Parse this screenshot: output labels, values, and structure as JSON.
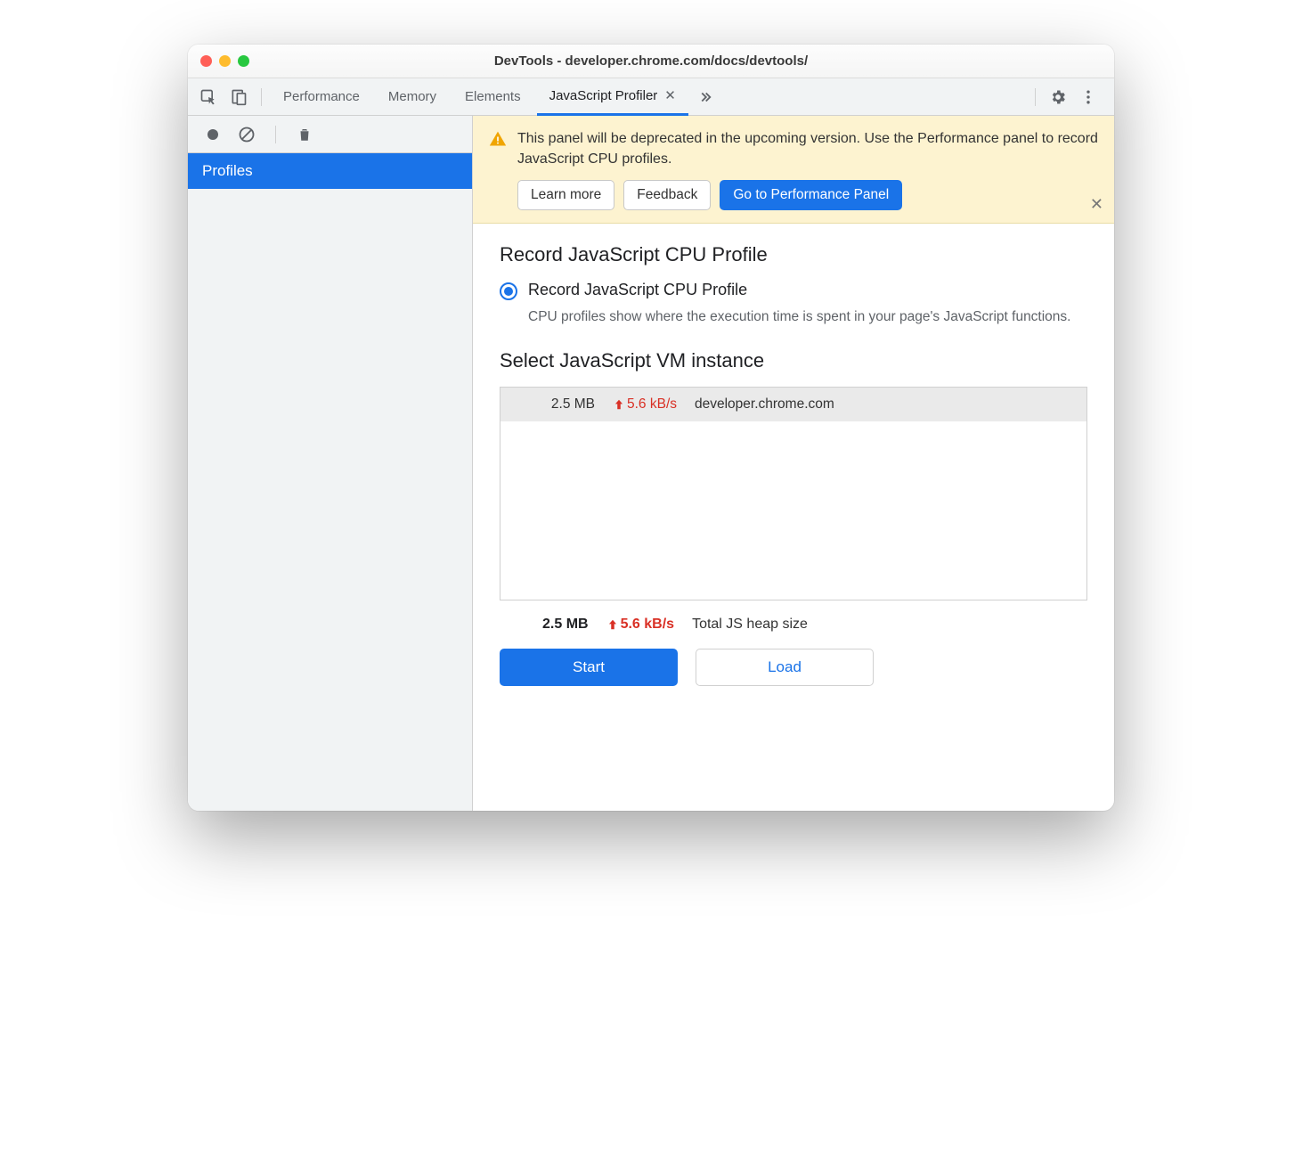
{
  "window": {
    "title": "DevTools - developer.chrome.com/docs/devtools/"
  },
  "tabs": {
    "items": [
      "Performance",
      "Memory",
      "Elements",
      "JavaScript Profiler"
    ],
    "active": "JavaScript Profiler"
  },
  "sidebar": {
    "profiles_label": "Profiles"
  },
  "banner": {
    "text": "This panel will be deprecated in the upcoming version. Use the Performance panel to record JavaScript CPU profiles.",
    "learn_more": "Learn more",
    "feedback": "Feedback",
    "goto": "Go to Performance Panel"
  },
  "content": {
    "heading1": "Record JavaScript CPU Profile",
    "radio_label": "Record JavaScript CPU Profile",
    "radio_desc": "CPU profiles show where the execution time is spent in your page's JavaScript functions.",
    "heading2": "Select JavaScript VM instance",
    "vm": {
      "size": "2.5 MB",
      "rate": "5.6 kB/s",
      "host": "developer.chrome.com"
    },
    "summary": {
      "size": "2.5 MB",
      "rate": "5.6 kB/s",
      "label": "Total JS heap size"
    },
    "start": "Start",
    "load": "Load"
  }
}
